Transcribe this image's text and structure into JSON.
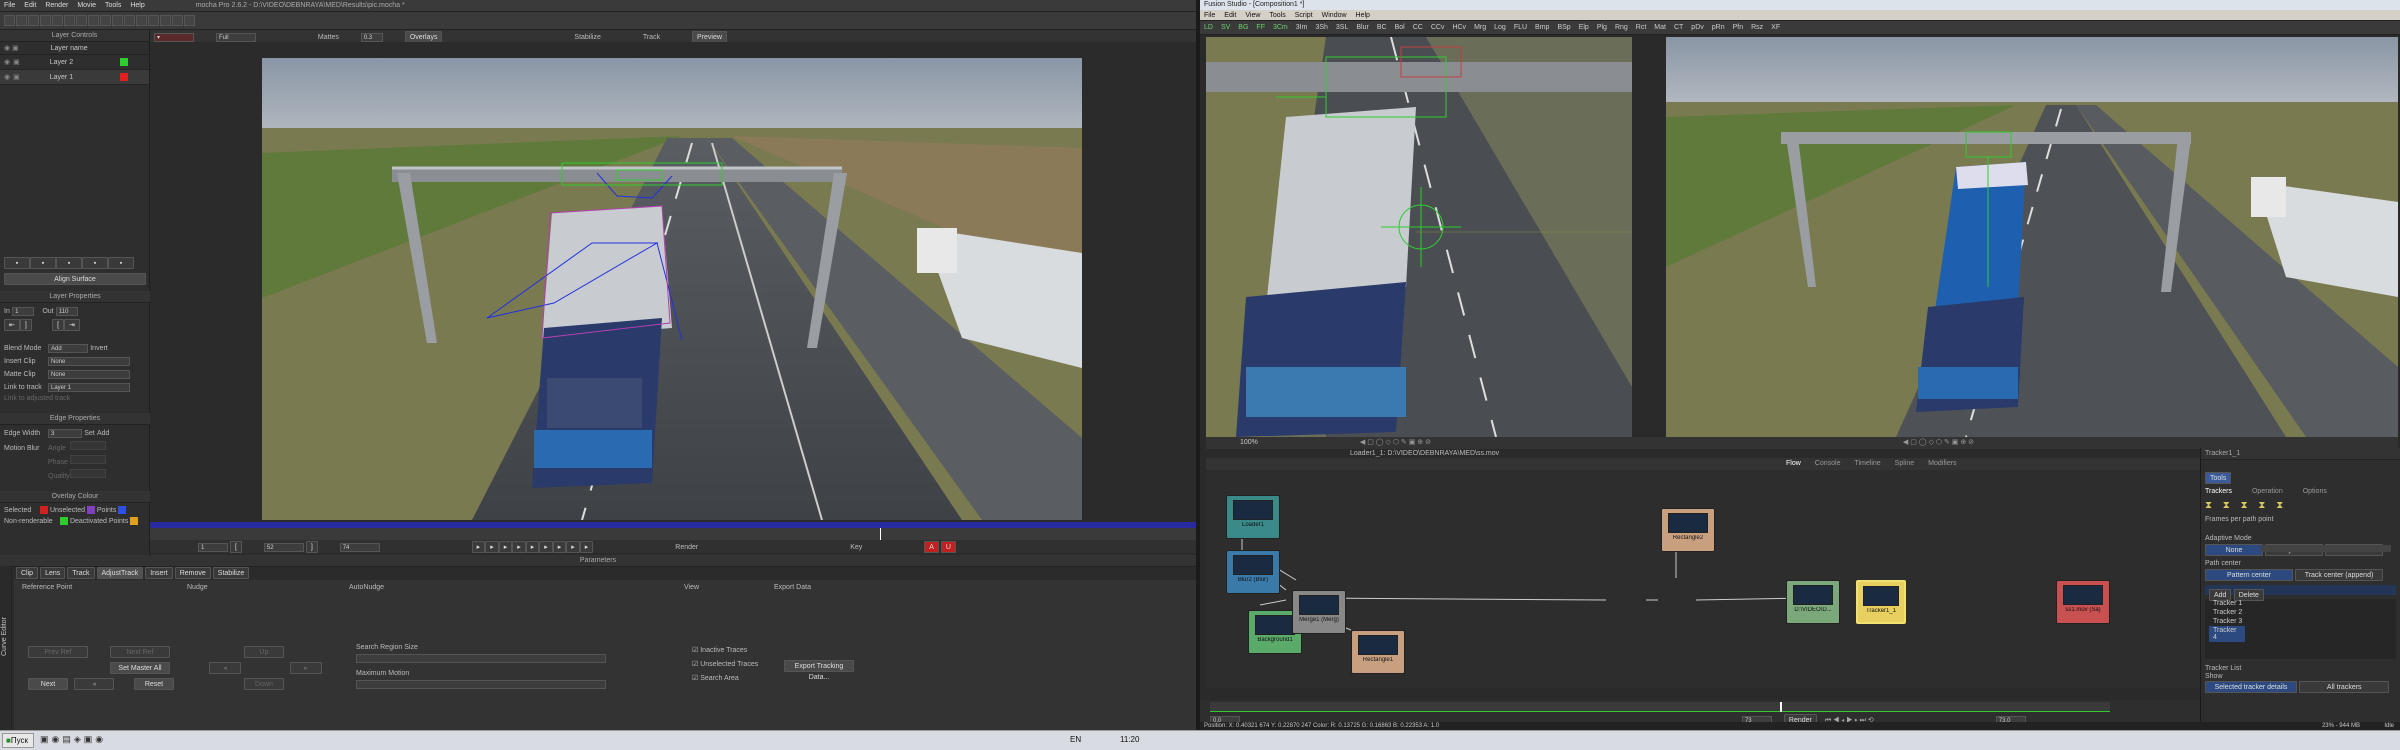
{
  "mocha": {
    "title": "mocha Pro 2.6.2 - D:\\VIDEO\\DEBNRAYA\\MED\\Results\\pic.mocha *",
    "menu": [
      "File",
      "Edit",
      "Render",
      "Movie",
      "Tools",
      "Help"
    ],
    "layer_controls_title": "Layer Controls",
    "layer_name_header": "Layer name",
    "layers": [
      {
        "name": "Layer 2",
        "color": "#2ecc2e"
      },
      {
        "name": "Layer 1",
        "color": "#e02020"
      }
    ],
    "view_bar": {
      "zoom": "Full",
      "mattes": "Mattes",
      "zoom_value": "0.3",
      "overlays": "Overlays",
      "stabilize": "Stabilize",
      "track": "Track",
      "preview": "Preview"
    },
    "align_surface": "Align Surface",
    "layer_properties_title": "Layer Properties",
    "in_label": "In",
    "in_value": "1",
    "out_label": "Out",
    "out_value": "110",
    "blend_mode_label": "Blend Mode",
    "blend_mode_value": "Add",
    "invert_label": "Invert",
    "insert_clip_label": "Insert Clip",
    "insert_clip_value": "None",
    "matte_clip_label": "Matte Clip",
    "matte_clip_value": "None",
    "link_to_track_label": "Link to track",
    "link_to_track_value": "Layer 1",
    "link_adjusted_label": "Link to adjusted track",
    "edge_properties_title": "Edge Properties",
    "edge_width_label": "Edge Width",
    "edge_width_value": "3",
    "set_label": "Set",
    "add_label": "Add",
    "motion_blur_label": "Motion Blur",
    "angle_label": "Angle",
    "phase_label": "Phase",
    "quality_label": "Quality",
    "overlay_colour_title": "Overlay Colour",
    "selected_label": "Selected",
    "unselected_label": "Unselected",
    "points_label": "Points",
    "non_renderable_label": "Non-renderable",
    "deactivated_points_label": "Deactivated Points",
    "timeline": {
      "start": "1",
      "current": "52",
      "end": "74",
      "render": "Render",
      "key": "Key"
    },
    "params_title": "Parameters",
    "tabs": [
      "Clip",
      "Lens",
      "Track",
      "AdjustTrack",
      "Insert",
      "Remove",
      "Stabilize"
    ],
    "active_tab": "AdjustTrack",
    "reference_point": "Reference Point",
    "nudge": "Nudge",
    "auto_nudge": "AutoNudge",
    "view_label": "View",
    "export_data_label": "Export Data",
    "prev_ref": "Prev Ref",
    "next_ref": "Next Ref",
    "set_master": "Set Master All",
    "next_btn": "Next",
    "reset_btn": "Reset",
    "up_btn": "Up",
    "down_btn": "Down",
    "search_region": "Search Region Size",
    "maximum_motion": "Maximum Motion",
    "inactive_traces": "Inactive Traces",
    "unselected_traces": "Unselected Traces",
    "search_area": "Search Area",
    "export_tracking": "Export Tracking Data...",
    "curve_editor": "Curve Editor"
  },
  "fusion": {
    "title": "Fusion Studio - [Composition1 *]",
    "menu": [
      "File",
      "Edit",
      "View",
      "Tools",
      "Script",
      "Window",
      "Help"
    ],
    "viewer_left_status": "100%",
    "viewer_left_label": "Loader1_1: D:\\VIDEO\\DEBNRAYA\\MED\\ss.mov",
    "tool_bar": [
      "LD",
      "SV",
      "BG",
      "FF",
      "3Cm",
      "3Im",
      "3Sh",
      "3SL",
      "Blur",
      "BC",
      "Bol",
      "CC",
      "CCv",
      "HCv",
      "Mrg",
      "Log",
      "FLU",
      "Bmp",
      "BSp",
      "Elp",
      "Plg",
      "Rng",
      "Rct",
      "Mat",
      "CT",
      "pDv",
      "pRn",
      "Pfn",
      "Rsz",
      "XF"
    ],
    "tabs": [
      "Flow",
      "Console",
      "Timeline",
      "Spline",
      "Modifiers"
    ],
    "active_tab": "Flow",
    "nodes": [
      {
        "label": "Loader1",
        "color": "#3a8a8a",
        "kind": "loader"
      },
      {
        "label": "Blur2 (Blur)",
        "color": "#3a7aa8",
        "kind": "blur"
      },
      {
        "label": "Background1",
        "color": "#5aaa6a",
        "kind": "bg"
      },
      {
        "label": "Merge1 (Merg)",
        "color": "#888888",
        "kind": "merge"
      },
      {
        "label": "Rectangle1",
        "color": "#c8a080",
        "kind": "rect"
      },
      {
        "label": "Rectangle2",
        "color": "#c8a080",
        "kind": "rect"
      },
      {
        "label": "D:\\VIDEO\\D...",
        "color": "#7aa87a",
        "kind": "loader2"
      },
      {
        "label": "Tracker1_1",
        "color": "#e8d060",
        "kind": "tracker"
      },
      {
        "label": "ss1.mov (Sa)",
        "color": "#c85050",
        "kind": "saver"
      }
    ],
    "inspector_title": "Tracker1_1",
    "inspector_tabs": [
      "Trackers",
      "Operation",
      "Options"
    ],
    "frames_per_path": "Frames per path point",
    "adaptive_mode": "Adaptive Mode",
    "adaptive_options": [
      "None",
      "Every Frame",
      "Best match"
    ],
    "path_center": "Path center",
    "path_center_options": [
      "Pattern center",
      "Track center (append)"
    ],
    "add_btn": "Add",
    "delete_btn": "Delete",
    "trackers": [
      "Tracker 1",
      "Tracker 2",
      "Tracker 3",
      "Tracker 4"
    ],
    "selected_tracker": "Tracker 4",
    "tracker_list": "Tracker List",
    "show_label": "Show",
    "selected_details": "Selected tracker details",
    "all_trackers": "All trackers",
    "time_start": "0.0",
    "time_current": "73",
    "time_end": "73.0",
    "render_label": "Render",
    "status": "Position: X: 0.40321  674  Y: 0.22870  247  Color: R: 0.13725  G: 0.16863  B: 0.22353  A: 1.0",
    "status_right": "23% - 944 MB",
    "idle": "Idle"
  },
  "taskbar": {
    "start": "Пуск",
    "lang": "EN",
    "clock": "11:20"
  }
}
